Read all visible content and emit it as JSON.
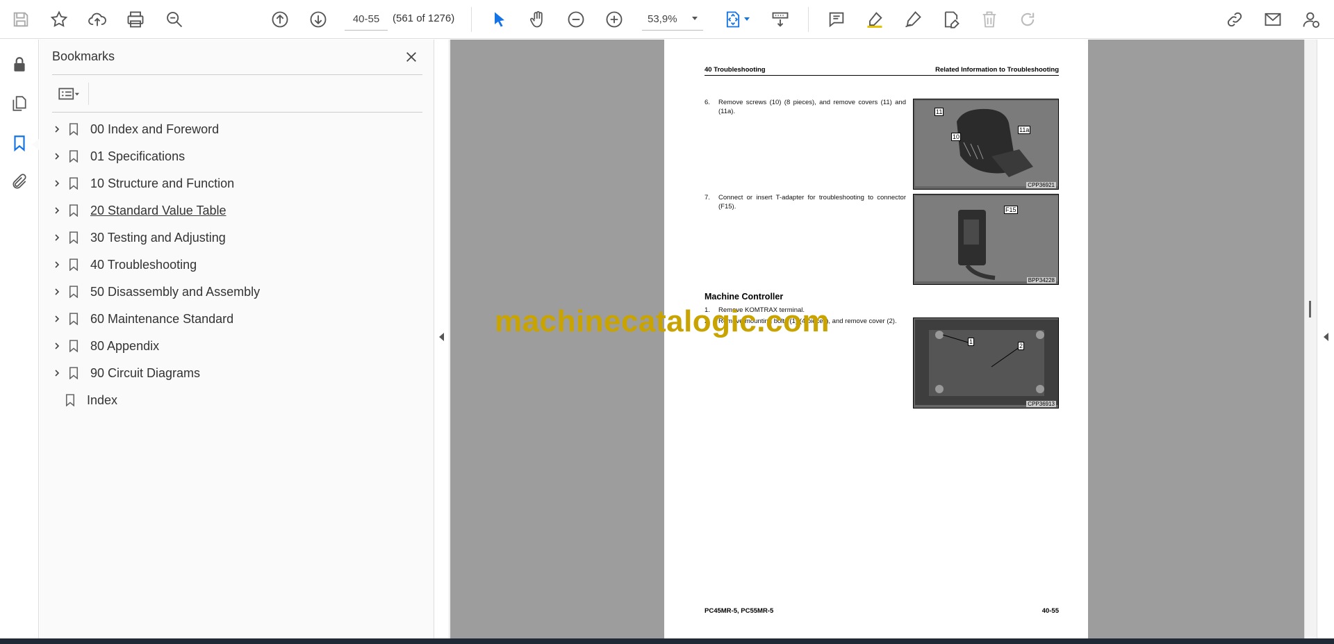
{
  "toolbar": {
    "page_input": "40-55",
    "page_count": "(561 of 1276)",
    "zoom_value": "53,9%"
  },
  "bookmarks_panel": {
    "title": "Bookmarks",
    "items": [
      {
        "label": "00 Index and Foreword",
        "expandable": true
      },
      {
        "label": "01 Specifications",
        "expandable": true
      },
      {
        "label": "10 Structure and Function",
        "expandable": true
      },
      {
        "label": "20 Standard Value Table",
        "expandable": true
      },
      {
        "label": "30 Testing and Adjusting",
        "expandable": true
      },
      {
        "label": "40 Troubleshooting",
        "expandable": true
      },
      {
        "label": "50 Disassembly and Assembly",
        "expandable": true
      },
      {
        "label": "60 Maintenance Standard",
        "expandable": true
      },
      {
        "label": "80 Appendix",
        "expandable": true
      },
      {
        "label": "90 Circuit Diagrams",
        "expandable": true
      },
      {
        "label": "Index",
        "expandable": false
      }
    ]
  },
  "document": {
    "header_left": "40 Troubleshooting",
    "header_right": "Related Information to Troubleshooting",
    "steps_a": [
      {
        "num": "6.",
        "text": "Remove screws (10) (8 pieces), and remove covers (11) and (11a)."
      },
      {
        "num": "7.",
        "text": "Connect or insert T-adapter for troubleshooting to connector (F15)."
      }
    ],
    "figures": [
      {
        "code": "CPP36921",
        "labels": [
          "11",
          "10",
          "11a"
        ]
      },
      {
        "code": "BPP34228",
        "labels": [
          "F15"
        ]
      },
      {
        "code": "CPP36913",
        "labels": [
          "1",
          "2"
        ]
      }
    ],
    "section_title": "Machine Controller",
    "steps_b": [
      {
        "num": "1.",
        "text": "Remove KOMTRAX terminal."
      },
      {
        "num": "2.",
        "text": "Remove mounting bolts (1) (4 pieces), and remove cover (2)."
      }
    ],
    "footer_left": "PC45MR-5, PC55MR-5",
    "footer_right": "40-55"
  },
  "watermark": "machinecatalogic.com",
  "colors": {
    "accent_blue": "#1473e6",
    "canvas_gray": "#9d9d9d",
    "watermark": "#c9a400"
  }
}
